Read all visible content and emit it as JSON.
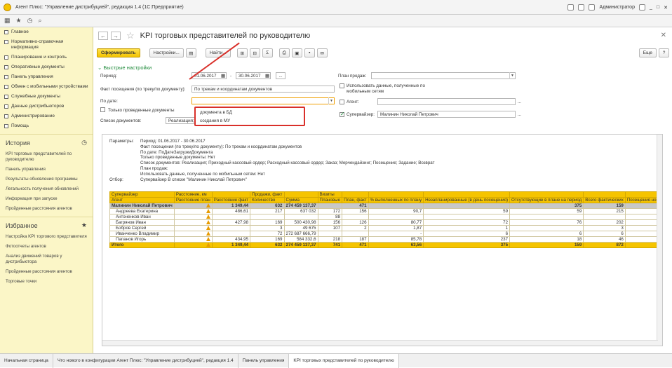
{
  "window": {
    "title": "Агент Плюс: \"Управление дистрибуцией\", редакция 1.4  (1С:Предприятие)",
    "user": "Администратор"
  },
  "sidebar": {
    "items": [
      "Главное",
      "Нормативно-справочная информация",
      "Планирование и контроль",
      "Оперативные документы",
      "Панель управления",
      "Обмен с мобильными устройствами",
      "Служебные документы",
      "Данные дистрибьюторов",
      "Администрирование",
      "Помощь"
    ],
    "history_title": "История",
    "history": [
      "KPI торговых представителей по руководителю",
      "Панель управления",
      "Результаты обновления программы",
      "Легальность получения обновлений",
      "Информация при запуске",
      "Пройденные расстояния агентов"
    ],
    "fav_title": "Избранное",
    "favorites": [
      "Настройка KPI торгового представителя",
      "Фотоотчеты агентов",
      "Анализ движений товаров у дистрибьютора",
      "Пройденные расстояния агентов",
      "Торговые точки"
    ]
  },
  "page": {
    "title": "KPI торговых представителей по руководителю"
  },
  "toolbar": {
    "generate": "Сформировать",
    "settings": "Настройки...",
    "find": "Найти...",
    "more": "Еще"
  },
  "quick": {
    "title": "Быстрые настройки"
  },
  "form": {
    "period_label": "Период:",
    "date_from": "01.06.2017",
    "date_to": "30.06.2017",
    "dash": "-",
    "dots": "...",
    "visit_label": "Факт посещения (по треку/по документу):",
    "visit_value": "По трекам и координатам документов",
    "bydate_label": "По дате:",
    "bydate_value": "",
    "only_posted": "Только проведенные документы",
    "doclist_label": "Список документов:",
    "doclist_value": "Реализация; Приходн",
    "plan_label": "План продаж:",
    "plan_value": "",
    "mobile_label": "Использовать данные, полученные по мобильным сетям",
    "agent_label": "Агент:",
    "agent_value": "",
    "supervisor_label": "Супервайзер:",
    "supervisor_value": "Малинин Николай Петрович"
  },
  "dropdown": {
    "options": [
      "документа в БД",
      "создания в МУ"
    ]
  },
  "report": {
    "params": [
      [
        "Параметры:",
        "Период: 01.06.2017 - 30.06.2017"
      ],
      [
        "",
        "Факт посещения (по треку/по документу): По трекам и координатам документов"
      ],
      [
        "",
        "По дате: ПоДатеЗагрузкиДокумента"
      ],
      [
        "",
        "Только проведенные документы: Нет"
      ],
      [
        "",
        "Список документов: Реализация; Приходный кассовый ордер; Расходный кассовый ордер; Заказ; Мерчендайзинг; Посещение; Задание; Возврат"
      ],
      [
        "",
        "План продаж:"
      ],
      [
        "",
        "Использовать данные, полученные по мобильным сетям: Нет"
      ],
      [
        "Отбор:",
        "Супервайзер В списке \"Малинин Николай Петрович\""
      ]
    ],
    "headers1": [
      "Супервайзер",
      "Расстояние, км",
      "",
      "Продажи, факт",
      "",
      "Визиты",
      "",
      "",
      "",
      "",
      "",
      "",
      "% неактивных",
      "Ср"
    ],
    "headers2": [
      "Агент",
      "Расстояние план",
      "Расстояние факт",
      "Количество",
      "Сумма",
      "Плановые",
      "План, факт",
      "% выполненных по плану",
      "Незапланированные (в день посещения)",
      "Отсутствующие в плане на период",
      "Всего фактических",
      "Посещения новых точек",
      "",
      ""
    ],
    "group": [
      "Малинин Николай Петрович",
      "",
      "1 349,44",
      "632",
      "274 459 137,37",
      "",
      "471",
      "",
      "",
      "375",
      "159",
      "",
      "157",
      "142,96"
    ],
    "rows": [
      [
        "Андреева Екатерина",
        "",
        "486,61",
        "217",
        "637 032",
        "172",
        "156",
        "90,7",
        "59",
        "59",
        "215",
        "32",
        "00,75",
        ""
      ],
      [
        "Антоненков Иван",
        "",
        "",
        "",
        "",
        "88",
        "",
        "",
        "",
        "",
        "",
        "",
        "",
        ""
      ],
      [
        "Багрянов Иван",
        "",
        "427,98",
        "169",
        "500 430,98",
        "156",
        "126",
        "80,77",
        "72",
        "76",
        "202",
        "43",
        "27,27",
        ""
      ],
      [
        "Бобров Сергей",
        "",
        "",
        "3",
        "49 675",
        "107",
        "2",
        "1,87",
        "1",
        "",
        "3",
        "1",
        "57,14",
        ""
      ],
      [
        "Иванченко Владимир",
        "",
        "",
        "72",
        "272 687 666,79",
        "",
        "",
        "-",
        "6",
        "6",
        "6",
        "",
        "",
        ""
      ],
      [
        "Папанов Игорь",
        "",
        "434,95",
        "169",
        "584 332,6",
        "218",
        "187",
        "85,78",
        "237",
        "18",
        "46",
        "81",
        "27,78",
        ""
      ]
    ],
    "total": [
      "Итого",
      "",
      "1 349,44",
      "632",
      "274 459 137,37",
      "741",
      "471",
      "63,56",
      "375",
      "159",
      "872",
      "157",
      "142,96",
      ""
    ]
  },
  "tabs": [
    "Начальная страница",
    "Что нового в конфигурации Агент Плюс: \"Управление дистрибуцией\", редакция 1.4",
    "Панель управления",
    "KPI торговых представителей по руководителю"
  ]
}
